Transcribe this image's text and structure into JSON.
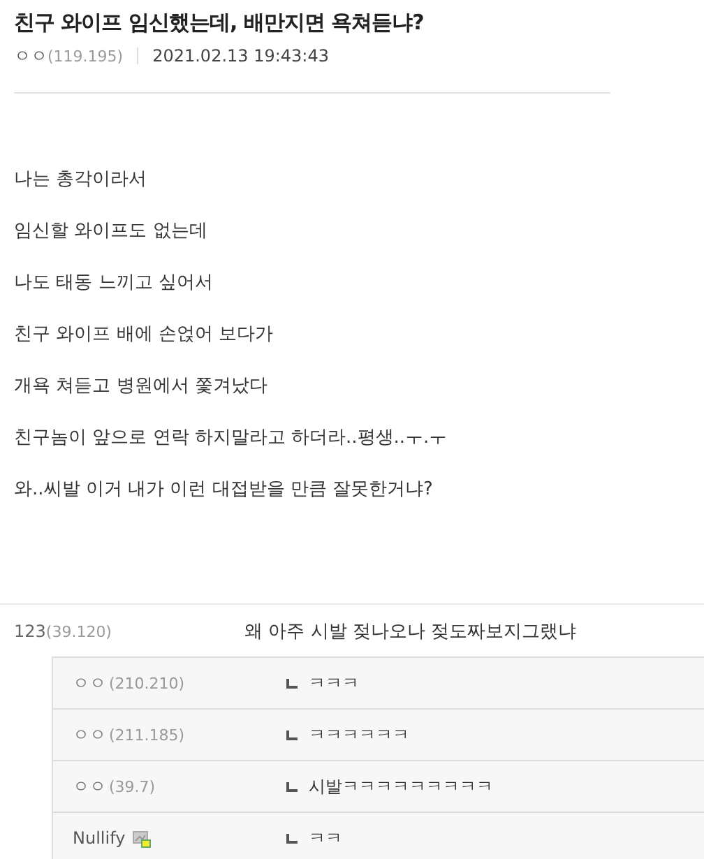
{
  "post": {
    "title": "친구 와이프 임신했는데, 배만지면 욕쳐듣냐?",
    "author": "ㅇㅇ",
    "ip": "(119.195)",
    "date": "2021.02.13 19:43:43",
    "body": [
      "나는 총각이라서",
      "임신할 와이프도 없는데",
      "나도 태동 느끼고 싶어서",
      "친구 와이프 배에 손얹어 보다가",
      "개욕 쳐듣고 병원에서 쫓겨났다",
      "친구놈이 앞으로 연락 하지말라고 하더라..평생..ㅜ.ㅜ",
      "와..씨발 이거 내가 이런 대접받을 만큼 잘못한거냐?"
    ]
  },
  "comments": [
    {
      "author": "123",
      "ip": "(39.120)",
      "text": "왜 아주 시발 젖나오나 젖도짜보지그랬냐",
      "replies": [
        {
          "author": "ㅇㅇ",
          "ip": "(210.210)",
          "text": "ㅋㅋㅋ",
          "member": false
        },
        {
          "author": "ㅇㅇ",
          "ip": "(211.185)",
          "text": "ㅋㅋㅋㅋㅋㅋ",
          "member": false
        },
        {
          "author": "ㅇㅇ",
          "ip": "(39.7)",
          "text": "시발ㅋㅋㅋㅋㅋㅋㅋㅋㅋ",
          "member": false
        },
        {
          "author": "Nullify",
          "text": "ㅋㅋ",
          "member": true
        }
      ]
    }
  ]
}
